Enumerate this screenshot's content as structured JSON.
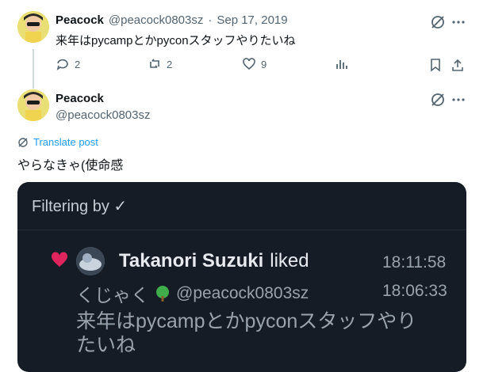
{
  "reply_tweet": {
    "author_name": "Peacock",
    "handle": "@peacock0803sz",
    "separator": "·",
    "date": "Sep 17, 2019",
    "text": "来年はpycampとかpyconスタッフやりたいね",
    "actions": {
      "replies": "2",
      "retweets": "2",
      "likes": "9",
      "views": ""
    }
  },
  "main_tweet": {
    "author_name": "Peacock",
    "handle": "@peacock0803sz",
    "translate_label": "Translate post",
    "text": "やらなきゃ(使命感"
  },
  "embedded_card": {
    "header": "Filtering by ✓",
    "liker_name": "Takanori Suzuki",
    "liked_label": "liked",
    "liked_time": "18:11:58",
    "original_author": "くじゃく",
    "original_handle": "@peacock0803sz",
    "original_time": "18:06:33",
    "original_text_line1": "来年はpycampとかpyconスタッフやり",
    "original_text_line2": "たいね",
    "colors": {
      "heart": "#e0245e",
      "background": "#151c26"
    }
  },
  "icons": [
    "grok-icon",
    "more-icon",
    "reply-icon",
    "retweet-icon",
    "like-icon",
    "views-icon",
    "bookmark-icon",
    "share-icon",
    "translate-icon",
    "tree-emoji-icon"
  ]
}
